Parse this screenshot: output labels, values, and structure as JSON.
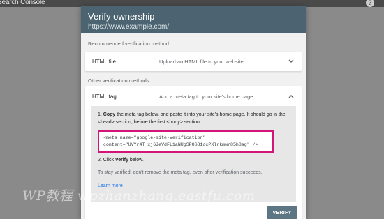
{
  "app": {
    "title": "Search Console"
  },
  "dialog": {
    "title": "Verify ownership",
    "subtitle": "https://www.example.com/"
  },
  "recommended": {
    "label": "Recommended verification method",
    "method": {
      "name": "HTML file",
      "description": "Upload an HTML file to your website"
    }
  },
  "other": {
    "label": "Other verification methods",
    "method": {
      "name": "HTML tag",
      "description": "Add a meta tag to your site's home page"
    },
    "step1": {
      "number": "1.",
      "bold": "Copy",
      "text_a": " the meta tag below, and paste it into your site's home page. It should go in the ",
      "head_tag": "<head>",
      "text_b": " section, before the first ",
      "body_tag": "<body>",
      "text_c": " section."
    },
    "code_line1": "<meta name=\"google-site-verification\"",
    "code_line2": "content=\"UVYr4T xj6JeVdFL1aNUgSPOS81ccPXlrkmwr85h8ag\" />",
    "step2": {
      "number": "2.",
      "text_a": " Click ",
      "bold": "Verify",
      "text_b": " below."
    },
    "stay_text": "To stay verified, don't remove the meta tag, even after verification succeeds.",
    "learn_more": "Learn more",
    "verify_button": "VERIFY"
  },
  "watermark": "WP教程  wpzhanzhang.eastfu.com",
  "icons": {
    "help": "help-circle-icon",
    "expand": "chevron-down-icon",
    "collapse": "chevron-up-icon"
  }
}
